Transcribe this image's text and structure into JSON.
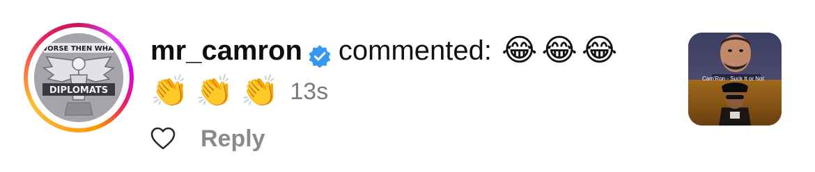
{
  "comment": {
    "username": "mr_camron",
    "verified": true,
    "action_text": "commented:",
    "emojis_line1": [
      "😂",
      "😂",
      "😂"
    ],
    "emojis_line2": [
      "👏",
      "👏",
      "👏"
    ],
    "timestamp": "13s"
  },
  "avatar": {
    "top_text": "WORSE THEN WHAT",
    "band_text": "DIPLOMATS"
  },
  "actions": {
    "like_icon": "heart-outline-icon",
    "reply_label": "Reply"
  },
  "thumbnail": {
    "caption": "Cam'Ron - Suck It or Not"
  },
  "colors": {
    "verified_blue": "#3897f0",
    "timestamp_gray": "#7b7b7b",
    "reply_gray": "#8a8a8a"
  }
}
